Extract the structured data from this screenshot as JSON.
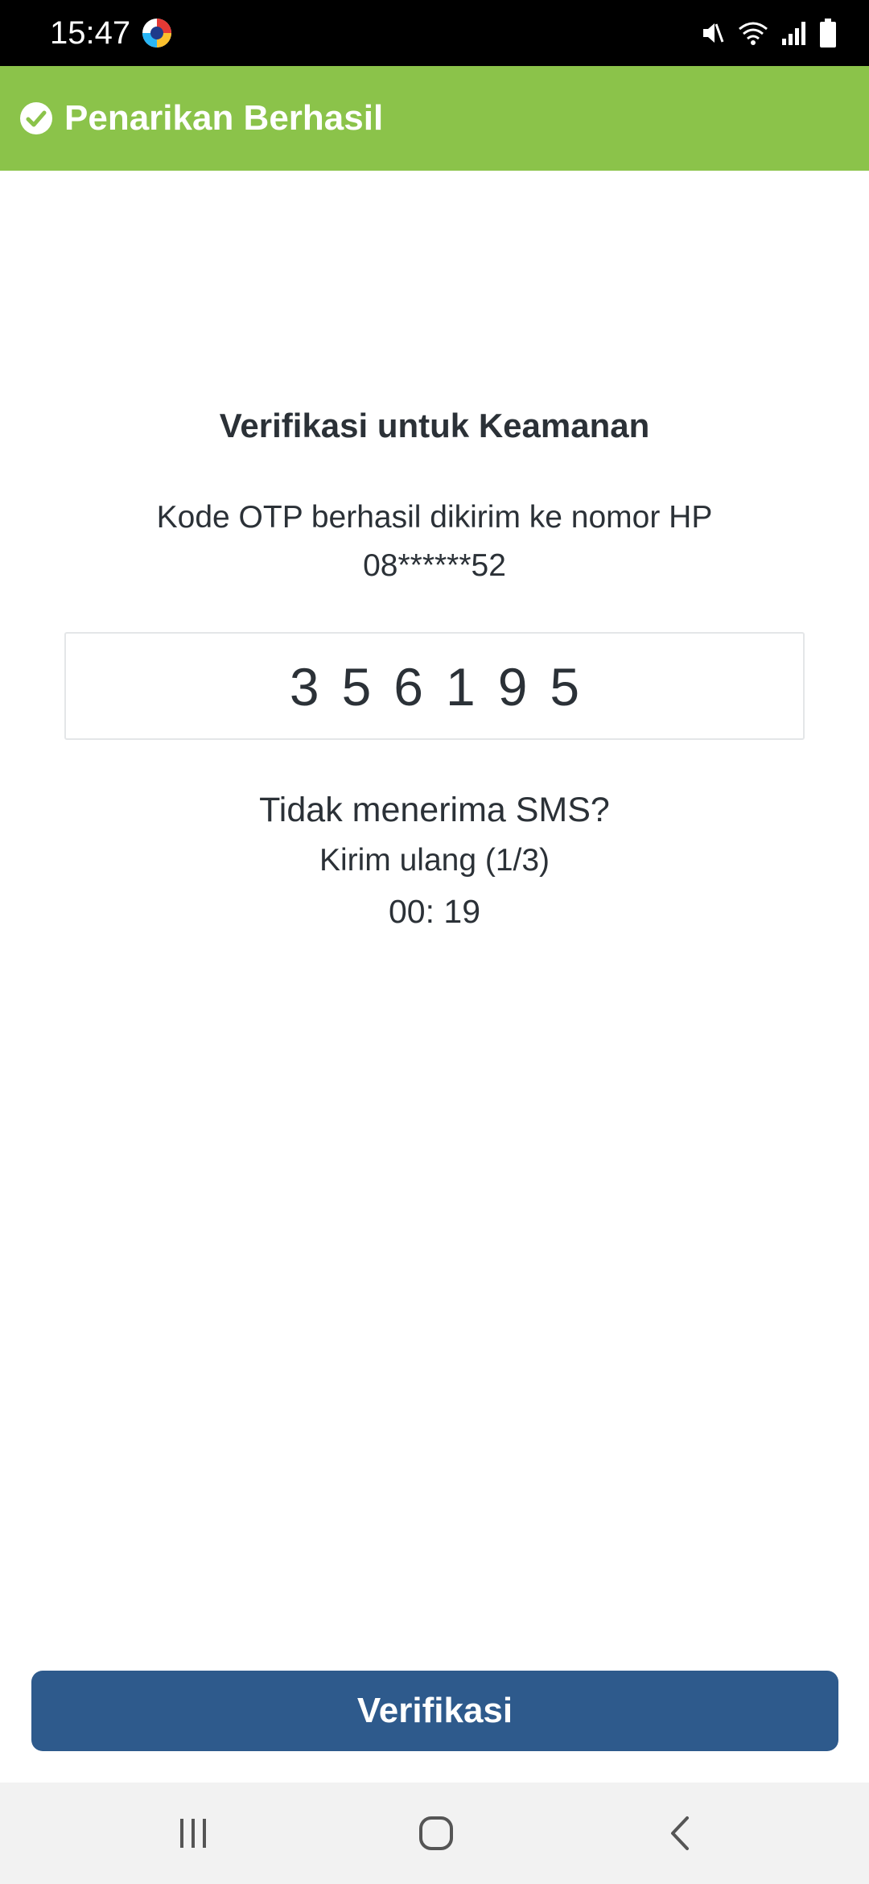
{
  "status_bar": {
    "time": "15:47",
    "icons": [
      "app-notification-icon",
      "mute-icon",
      "wifi-icon",
      "signal-icon",
      "battery-icon"
    ]
  },
  "toast": {
    "message": "Penarikan Berhasil",
    "icon": "check-circle-icon",
    "color": "#8bc34a"
  },
  "verification": {
    "title": "Verifikasi untuk Keamanan",
    "description_line1": "Kode OTP berhasil dikirim ke nomor HP",
    "phone_masked": "08******52",
    "otp_value": "356195",
    "no_sms_text": "Tidak menerima SMS?",
    "resend_label": "Kirim ulang  (1/3)",
    "timer": "00: 19"
  },
  "actions": {
    "verify_label": "Verifikasi",
    "verify_color": "#2e5a8c"
  },
  "nav_bar": {
    "buttons": [
      "recents-icon",
      "home-icon",
      "back-icon"
    ]
  }
}
